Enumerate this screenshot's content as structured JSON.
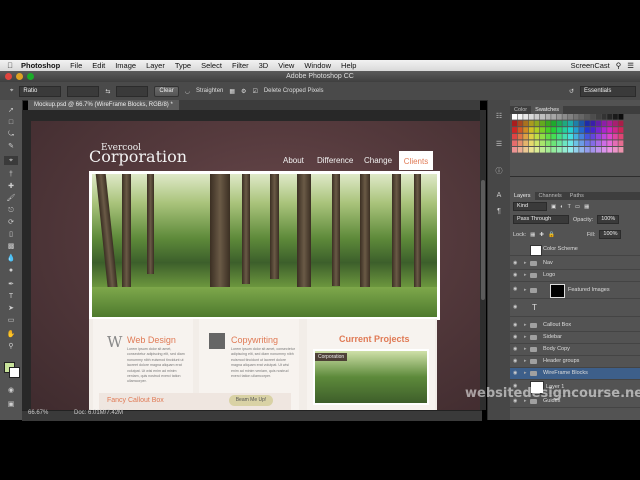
{
  "menubar": {
    "app": "Photoshop",
    "items": [
      "File",
      "Edit",
      "Image",
      "Layer",
      "Type",
      "Select",
      "Filter",
      "3D",
      "View",
      "Window",
      "Help"
    ],
    "right_label": "ScreenCast"
  },
  "window": {
    "title": "Adobe Photoshop CC"
  },
  "options": {
    "ratio_value": "Ratio",
    "clear_label": "Clear",
    "straighten_label": "Straighten",
    "delete_cropped_label": "Delete Cropped Pixels",
    "workspace_value": "Essentials"
  },
  "document": {
    "tab_label": "Mockup.psd @ 66.7% (WireFrame Blocks, RGB/8) *",
    "zoom": "66.67%",
    "doc_info": "Doc: 6.01M/7.42M"
  },
  "site": {
    "logo_small": "Evercool",
    "logo_big": "Corporation",
    "nav": [
      "About",
      "Difference",
      "Change"
    ],
    "nav_active": "Clients",
    "col1_title": "Web Design",
    "col1_initial": "W",
    "col2_title": "Copywriting",
    "col3_title": "Current Projects",
    "project_caption": "Corporation",
    "callout_title": "Fancy Callout Box",
    "callout_button": "Beam Me Up!",
    "lorem": "Lorem ipsum dolor sit amet, consectetur adipiscing elit, sed diam nonummy nibh euismod tincidunt ut laoreet dolore magna aliquam erat volutpat. Ut wisi enim ad minim veniam, quis nostrud exerci tation ullamcorper."
  },
  "panels": {
    "top_tabs": [
      "Color",
      "Swatches"
    ],
    "top_active": "Swatches",
    "layer_tabs": [
      "Layers",
      "Channels",
      "Paths"
    ],
    "kind_value": "Kind",
    "blend_mode": "Pass Through",
    "opacity_label": "Opacity:",
    "opacity_value": "100%",
    "lock_label": "Lock:",
    "fill_label": "Fill:",
    "fill_value": "100%",
    "layers": [
      {
        "name": "Color Scheme",
        "type": "thumb"
      },
      {
        "name": "Nav",
        "type": "folder"
      },
      {
        "name": "Logo",
        "type": "folder"
      },
      {
        "name": "Featured Images",
        "type": "mask"
      },
      {
        "name": "",
        "type": "text"
      },
      {
        "name": "Callout Box",
        "type": "folder"
      },
      {
        "name": "Sidebar",
        "type": "folder"
      },
      {
        "name": "Body Copy",
        "type": "folder"
      },
      {
        "name": "Header groups",
        "type": "folder"
      },
      {
        "name": "WireFrame Blocks",
        "type": "folder",
        "selected": true
      },
      {
        "name": "Layer 1",
        "type": "thumb"
      },
      {
        "name": "Guides",
        "type": "folder"
      }
    ]
  },
  "watermark": "websitedesigncourse.net",
  "colors": {
    "accent": "#e07a55",
    "selection": "#3d5f8a",
    "doc_bg": "#553a3d"
  }
}
